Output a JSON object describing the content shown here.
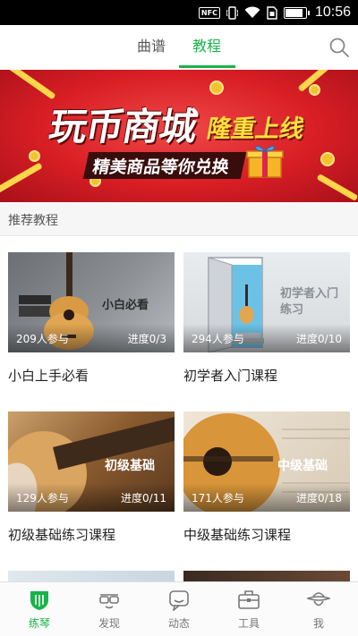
{
  "status_bar": {
    "nfc_label": "NFC",
    "time": "10:56",
    "icons": [
      "nfc-icon",
      "vibrate-icon",
      "wifi-icon",
      "sim-icon",
      "battery-icon"
    ]
  },
  "top_nav": {
    "tabs": [
      {
        "label": "曲谱",
        "active": false
      },
      {
        "label": "教程",
        "active": true
      }
    ],
    "search_icon": "search-icon",
    "accent_color": "#19b34a"
  },
  "banner": {
    "title": "玩币商城",
    "title_accent": "隆重上线",
    "subtitle": "精美商品等你兑换"
  },
  "section": {
    "title": "推荐教程"
  },
  "courses": [
    {
      "thumb_caption": "小白必看",
      "learners": "209人参与",
      "progress": "进度0/3",
      "title": "小白上手必看"
    },
    {
      "thumb_caption": "初学者入门练习",
      "learners": "294人参与",
      "progress": "进度0/10",
      "title": "初学者入门课程"
    },
    {
      "thumb_caption": "初级基础",
      "learners": "129人参与",
      "progress": "进度0/11",
      "title": "初级基础练习课程"
    },
    {
      "thumb_caption": "中级基础",
      "learners": "171人参与",
      "progress": "进度0/18",
      "title": "中级基础练习课程"
    }
  ],
  "bottom_nav": {
    "items": [
      {
        "label": "练琴",
        "icon": "guitar-pick-icon",
        "active": true
      },
      {
        "label": "发现",
        "icon": "glasses-icon",
        "active": false
      },
      {
        "label": "动态",
        "icon": "chat-bubble-icon",
        "active": false
      },
      {
        "label": "工具",
        "icon": "toolbox-icon",
        "active": false
      },
      {
        "label": "我",
        "icon": "profile-hat-icon",
        "active": false
      }
    ]
  }
}
